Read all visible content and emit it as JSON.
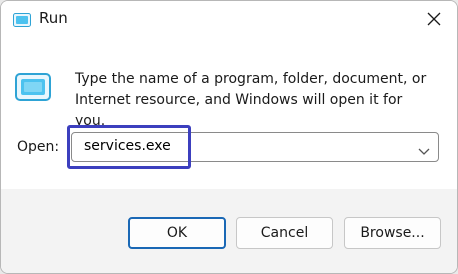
{
  "window": {
    "title": "Run",
    "icons": {
      "app": "run-icon",
      "close": "close-icon",
      "description": "run-icon",
      "dropdown": "chevron-down-icon"
    }
  },
  "description": "Type the name of a program, folder, document, or Internet resource, and Windows will open it for you.",
  "open": {
    "label": "Open:",
    "value": "services.exe"
  },
  "buttons": {
    "ok": "OK",
    "cancel": "Cancel",
    "browse": "Browse..."
  },
  "colors": {
    "accent": "#1a68b5",
    "highlight": "#3c3fbe",
    "icon": "#2ea3d5"
  }
}
